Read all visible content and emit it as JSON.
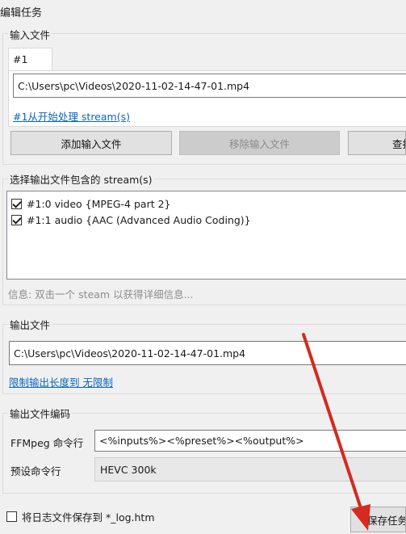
{
  "window": {
    "title": "编辑任务"
  },
  "input_group": {
    "title": "输入文件",
    "tab_label": "#1",
    "file_path": "C:\\Users\\pc\\Videos\\2020-11-02-14-47-01.mp4",
    "process_link": "#1从开始处理 stream(s)",
    "buttons": {
      "add": "添加输入文件",
      "remove": "移除输入文件",
      "search": "查找"
    }
  },
  "stream_group": {
    "title": "选择输出文件包含的 stream(s)",
    "streams": [
      {
        "label": "#1:0 video {MPEG-4 part 2}",
        "checked": true
      },
      {
        "label": "#1:1 audio {AAC (Advanced Audio Coding)}",
        "checked": true
      }
    ],
    "info_hint": "信息: 双击一个 steam 以获得详细信息..."
  },
  "output_group": {
    "title": "输出文件",
    "file_path": "C:\\Users\\pc\\Videos\\2020-11-02-14-47-01.mp4",
    "limit_link": "限制输出长度到 无限制"
  },
  "encoding_group": {
    "title": "输出文件编码",
    "ffmpeg_label": "FFMpeg 命令行",
    "ffmpeg_value": "<%inputs%><%preset%><%output%>",
    "preset_label": "预设命令行",
    "preset_value": "HEVC 300k"
  },
  "footer": {
    "save_log_label": "将日志文件保存到 *_log.htm",
    "save_log_checked": false,
    "save_task_label": "保存任务"
  },
  "colors": {
    "link": "#0a66c2",
    "annotation_arrow": "#d42a20"
  }
}
